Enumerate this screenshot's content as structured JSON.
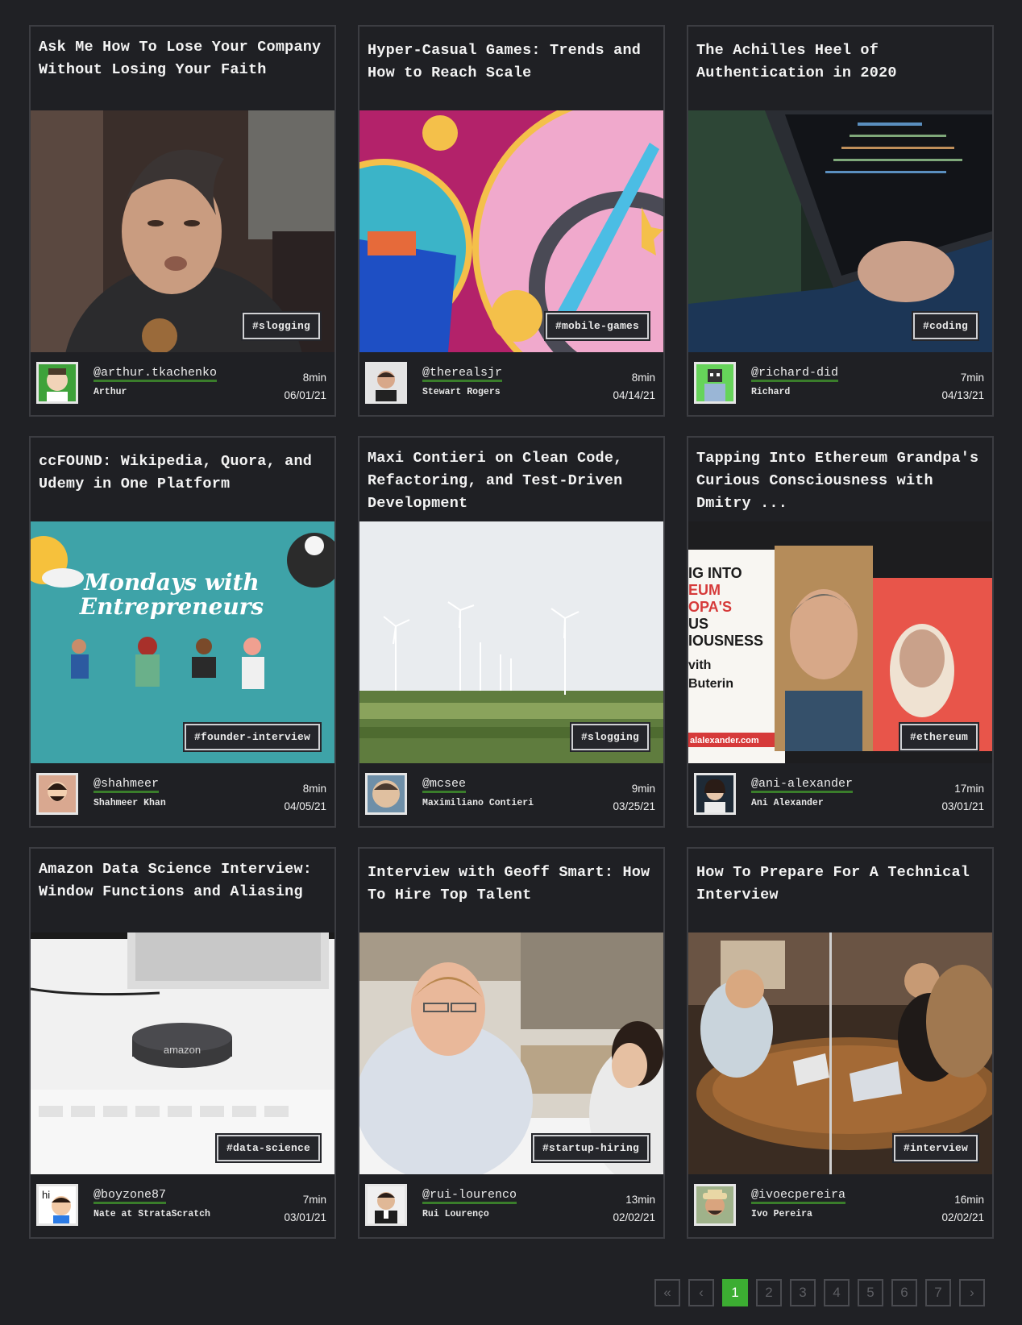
{
  "cards": [
    {
      "title": "Ask Me How To Lose Your Company Without Losing Your Faith",
      "tag": "#slogging",
      "handle": "@arthur.tkachenko",
      "author": "Arthur",
      "read_time": "8min",
      "date": "06/01/21"
    },
    {
      "title": "Hyper-Casual Games: Trends and How to Reach Scale",
      "tag": "#mobile-games",
      "handle": "@therealsjr",
      "author": "Stewart Rogers",
      "read_time": "8min",
      "date": "04/14/21"
    },
    {
      "title": "The Achilles Heel of Authentication in 2020",
      "tag": "#coding",
      "handle": "@richard-did",
      "author": "Richard",
      "read_time": "7min",
      "date": "04/13/21"
    },
    {
      "title": "ccFOUND: Wikipedia, Quora, and Udemy in One Platform",
      "tag": "#founder-interview",
      "handle": "@shahmeer",
      "author": "Shahmeer Khan",
      "read_time": "8min",
      "date": "04/05/21",
      "image_text": "Mondays with Entrepreneurs"
    },
    {
      "title": "Maxi Contieri on Clean Code, Refactoring, and Test-Driven Development",
      "tag": "#slogging",
      "handle": "@mcsee",
      "author": "Maximiliano Contieri",
      "read_time": "9min",
      "date": "03/25/21"
    },
    {
      "title": "Tapping Into Ethereum Grandpa's Curious Consciousness with Dmitry ...",
      "tag": "#ethereum",
      "handle": "@ani-alexander",
      "author": "Ani Alexander",
      "read_time": "17min",
      "date": "03/01/21",
      "image_text": [
        "IG INTO",
        "EUM",
        "OPA'S",
        "US",
        "IOUSNESS",
        "vith",
        "Buterin",
        "alalexander.com"
      ]
    },
    {
      "title": "Amazon Data Science Interview: Window Functions and Aliasing",
      "tag": "#data-science",
      "handle": "@boyzone87",
      "author": "Nate at StrataScratch",
      "read_time": "7min",
      "date": "03/01/21",
      "image_text": "amazon"
    },
    {
      "title": "Interview with Geoff Smart: How To Hire Top Talent",
      "tag": "#startup-hiring",
      "handle": "@rui-lourenco",
      "author": "Rui Lourenço",
      "read_time": "13min",
      "date": "02/02/21"
    },
    {
      "title": "How To Prepare For A Technical Interview",
      "tag": "#interview",
      "handle": "@ivoecpereira",
      "author": "Ivo Pereira",
      "read_time": "16min",
      "date": "02/02/21"
    }
  ],
  "pagination": {
    "first": "«",
    "prev": "‹",
    "pages": [
      "1",
      "2",
      "3",
      "4",
      "5",
      "6",
      "7"
    ],
    "next": "›",
    "current": "1"
  }
}
